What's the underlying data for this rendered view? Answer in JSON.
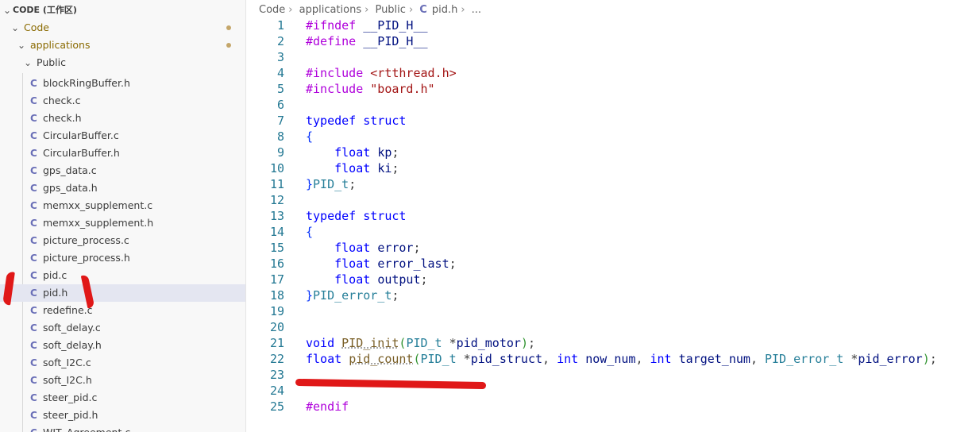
{
  "sidebar": {
    "workspace_title": "CODE (工作区)",
    "folders": [
      {
        "label": "Code"
      },
      {
        "label": "applications"
      },
      {
        "label": "Public"
      }
    ],
    "files": [
      {
        "name": "blockRingBuffer.h",
        "icon": "C"
      },
      {
        "name": "check.c",
        "icon": "C"
      },
      {
        "name": "check.h",
        "icon": "C"
      },
      {
        "name": "CircularBuffer.c",
        "icon": "C"
      },
      {
        "name": "CircularBuffer.h",
        "icon": "C"
      },
      {
        "name": "gps_data.c",
        "icon": "C"
      },
      {
        "name": "gps_data.h",
        "icon": "C"
      },
      {
        "name": "memxx_supplement.c",
        "icon": "C"
      },
      {
        "name": "memxx_supplement.h",
        "icon": "C"
      },
      {
        "name": "picture_process.c",
        "icon": "C"
      },
      {
        "name": "picture_process.h",
        "icon": "C"
      },
      {
        "name": "pid.c",
        "icon": "C"
      },
      {
        "name": "pid.h",
        "icon": "C"
      },
      {
        "name": "redefine.c",
        "icon": "C"
      },
      {
        "name": "soft_delay.c",
        "icon": "C"
      },
      {
        "name": "soft_delay.h",
        "icon": "C"
      },
      {
        "name": "soft_I2C.c",
        "icon": "C"
      },
      {
        "name": "soft_I2C.h",
        "icon": "C"
      },
      {
        "name": "steer_pid.c",
        "icon": "C"
      },
      {
        "name": "steer_pid.h",
        "icon": "C"
      },
      {
        "name": "WIT_Agreement.c",
        "icon": "C"
      }
    ],
    "selected_file": "pid.h"
  },
  "breadcrumb": {
    "items": [
      "Code",
      "applications",
      "Public",
      "pid.h",
      "..."
    ],
    "file_icon": "C"
  },
  "editor": {
    "line_numbers": [
      "1",
      "2",
      "3",
      "4",
      "5",
      "6",
      "7",
      "8",
      "9",
      "10",
      "11",
      "12",
      "13",
      "14",
      "15",
      "16",
      "17",
      "18",
      "19",
      "20",
      "21",
      "22",
      "23",
      "24",
      "25"
    ],
    "lines": [
      "#ifndef __PID_H__",
      "#define __PID_H__",
      "",
      "#include <rtthread.h>",
      "#include \"board.h\"",
      "",
      "typedef struct",
      "{",
      "    float kp;",
      "    float ki;",
      "}PID_t;",
      "",
      "typedef struct",
      "{",
      "    float error;",
      "    float error_last;",
      "    float output;",
      "}PID_error_t;",
      "",
      "",
      "void PID_init(PID_t *pid_motor);",
      "float pid_count(PID_t *pid_struct, int now_num, int target_num, PID_error_t *pid_error);",
      "",
      "",
      "#endif"
    ]
  },
  "colors": {
    "keyword": "#0000ff",
    "preprocessor": "#af00db",
    "string": "#a31515",
    "type": "#267f99",
    "function": "#795e26",
    "variable": "#001080",
    "line_number": "#237893",
    "annotation": "#e01818",
    "c_file_icon": "#6a6fb7",
    "modified_dot": "#c4a66a"
  }
}
